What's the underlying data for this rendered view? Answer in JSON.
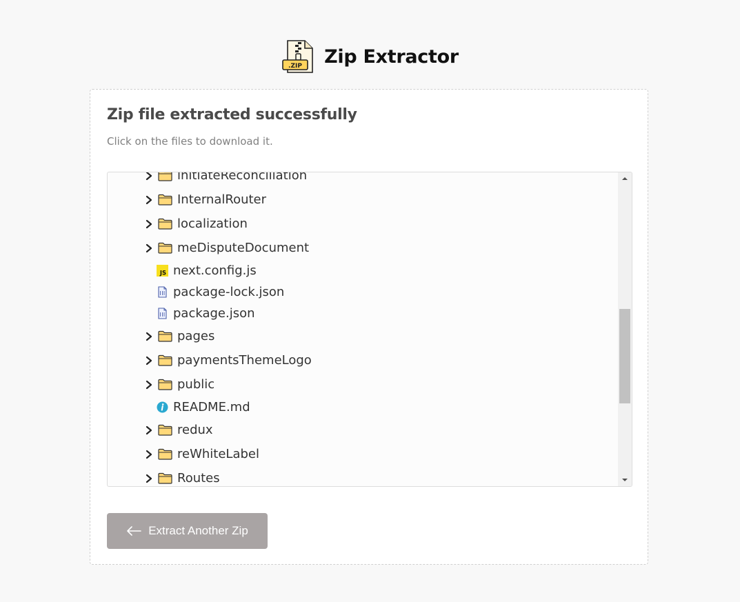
{
  "app": {
    "title": "Zip Extractor",
    "logo_text": ".ZIP"
  },
  "result": {
    "title": "Zip file extracted successfully",
    "subtitle": "Click on the files to download it."
  },
  "tree": {
    "items": [
      {
        "type": "folder",
        "name": "initiateReconciliation"
      },
      {
        "type": "folder",
        "name": "InternalRouter"
      },
      {
        "type": "folder",
        "name": "localization"
      },
      {
        "type": "folder",
        "name": "meDisputeDocument"
      },
      {
        "type": "file",
        "icon": "js",
        "name": "next.config.js"
      },
      {
        "type": "file",
        "icon": "json",
        "name": "package-lock.json"
      },
      {
        "type": "file",
        "icon": "json",
        "name": "package.json"
      },
      {
        "type": "folder",
        "name": "pages"
      },
      {
        "type": "folder",
        "name": "paymentsThemeLogo"
      },
      {
        "type": "folder",
        "name": "public"
      },
      {
        "type": "file",
        "icon": "info",
        "name": "README.md"
      },
      {
        "type": "folder",
        "name": "redux"
      },
      {
        "type": "folder",
        "name": "reWhiteLabel"
      },
      {
        "type": "folder",
        "name": "Routes"
      }
    ]
  },
  "actions": {
    "extract_another_label": "Extract Another Zip"
  },
  "colors": {
    "button_bg": "#a9a4a4",
    "folder_fill": "#ffd97a",
    "js_badge": "#f7df1e",
    "info_icon": "#2aa8d0",
    "page_bg": "#f8f8f8"
  }
}
